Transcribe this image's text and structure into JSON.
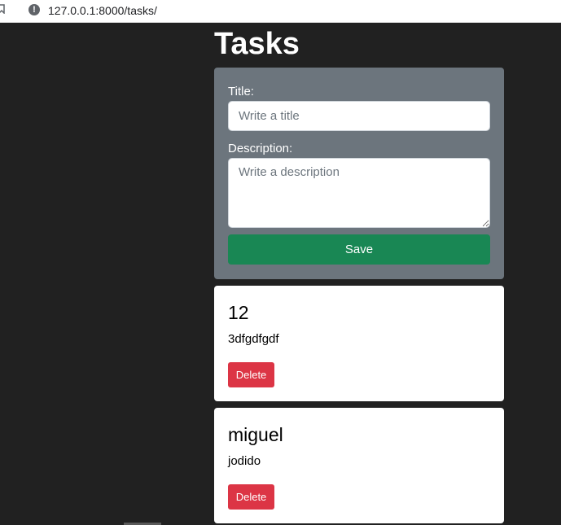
{
  "browser": {
    "url": "127.0.0.1:8000/tasks/",
    "info_glyph": "!"
  },
  "page": {
    "title": "Tasks"
  },
  "form": {
    "title_label": "Title:",
    "title_placeholder": "Write a title",
    "title_value": "",
    "description_label": "Description:",
    "description_placeholder": "Write a description",
    "description_value": "",
    "save_label": "Save"
  },
  "tasks": [
    {
      "title": "12",
      "description": "3dfgdfgdf",
      "delete_label": "Delete"
    },
    {
      "title": "miguel",
      "description": "jodido",
      "delete_label": "Delete"
    }
  ],
  "colors": {
    "background": "#212121",
    "form_card": "#6c757d",
    "save_button": "#198754",
    "delete_button": "#dc3545"
  }
}
